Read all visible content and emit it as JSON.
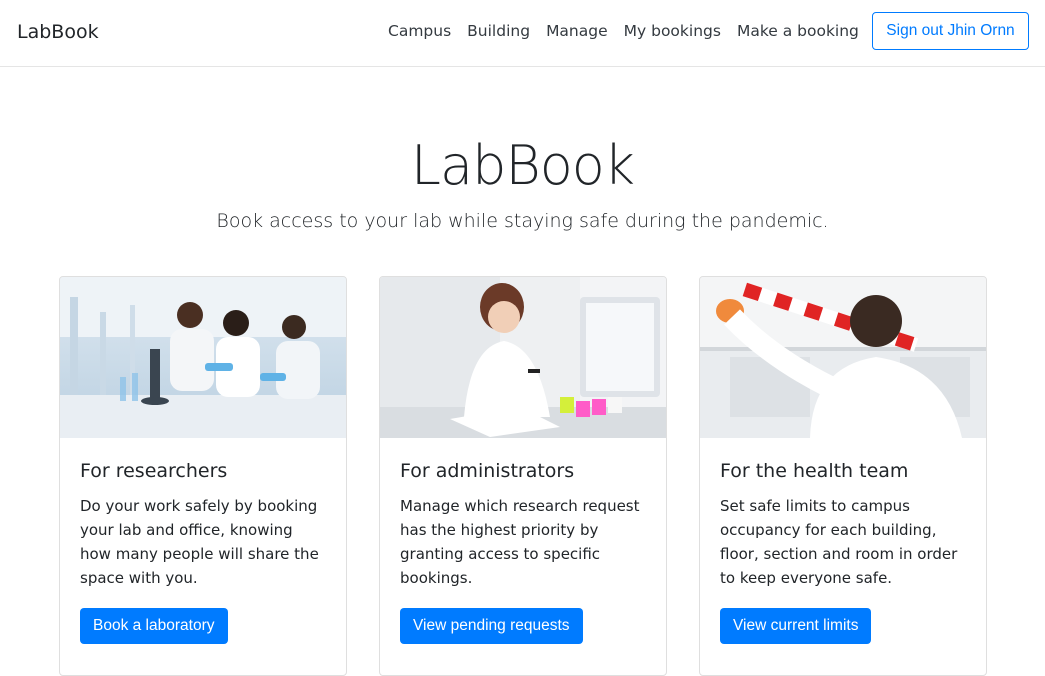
{
  "navbar": {
    "brand": "LabBook",
    "links": [
      "Campus",
      "Building",
      "Manage",
      "My bookings",
      "Make a booking"
    ],
    "signout_label": "Sign out Jhin Ornn"
  },
  "hero": {
    "title": "LabBook",
    "lead": "Book access to your lab while staying safe during the pandemic."
  },
  "cards": [
    {
      "title": "For researchers",
      "text": "Do your work safely by booking your lab and office, knowing how many people will share the space with you.",
      "button": "Book a laboratory",
      "image": "researchers-in-lab-photo"
    },
    {
      "title": "For administrators",
      "text": "Manage which research request has the highest priority by granting access to specific bookings.",
      "button": "View pending requests",
      "image": "administrator-writing-photo"
    },
    {
      "title": "For the health team",
      "text": "Set safe limits to campus occupancy for each building, floor, section and room in order to keep everyone safe.",
      "button": "View current limits",
      "image": "health-worker-taping-photo"
    }
  ],
  "colors": {
    "primary": "#007bff",
    "text": "#212529",
    "border": "#dfdfdf"
  }
}
